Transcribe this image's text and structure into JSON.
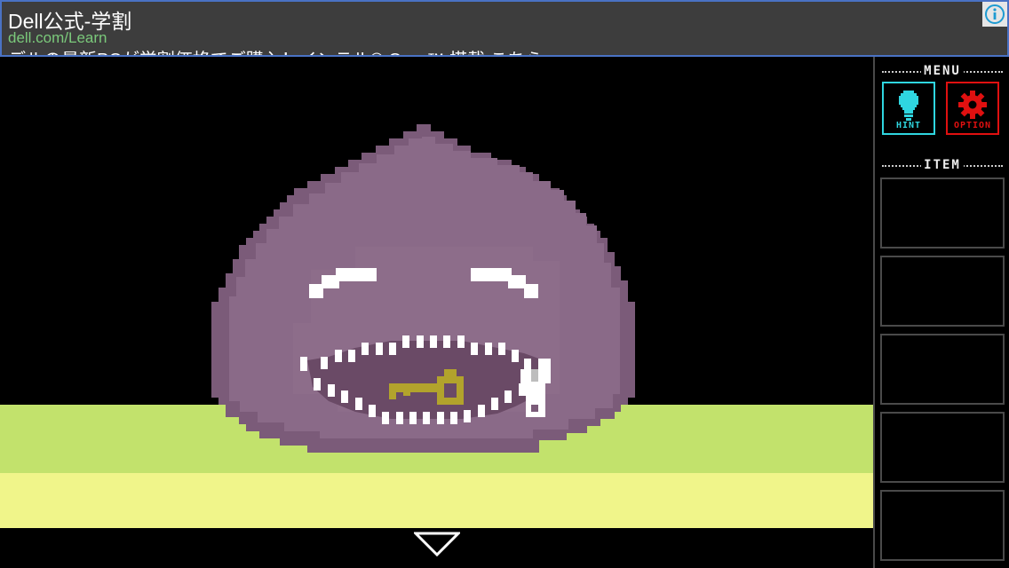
{
  "ad": {
    "title": "Dell公式-学割",
    "url": "dell.com/Learn",
    "description": "デルの最新PCが学割価格でご購入！インテル® Core™ 搭載 こちら",
    "info_icon": "info-icon"
  },
  "scene": {
    "colors": {
      "background": "#000000",
      "ground_top": "#c2e26c",
      "ground_bottom": "#f0f58a",
      "slime_body": "#8a6a88",
      "slime_dark": "#7b5b79",
      "mouth": "#6a4a66",
      "teeth": "#ffffff",
      "key": "#b2a32c"
    },
    "objects": [
      "purple-slime-monster",
      "golden-key",
      "down-arrow-icon"
    ]
  },
  "sidebar": {
    "menu_title": "MENU",
    "hint_label": "HINT",
    "option_label": "OPTION",
    "item_title": "ITEM",
    "item_slot_count": 5,
    "colors": {
      "hint": "#2fd6e0",
      "option": "#e01010"
    }
  }
}
